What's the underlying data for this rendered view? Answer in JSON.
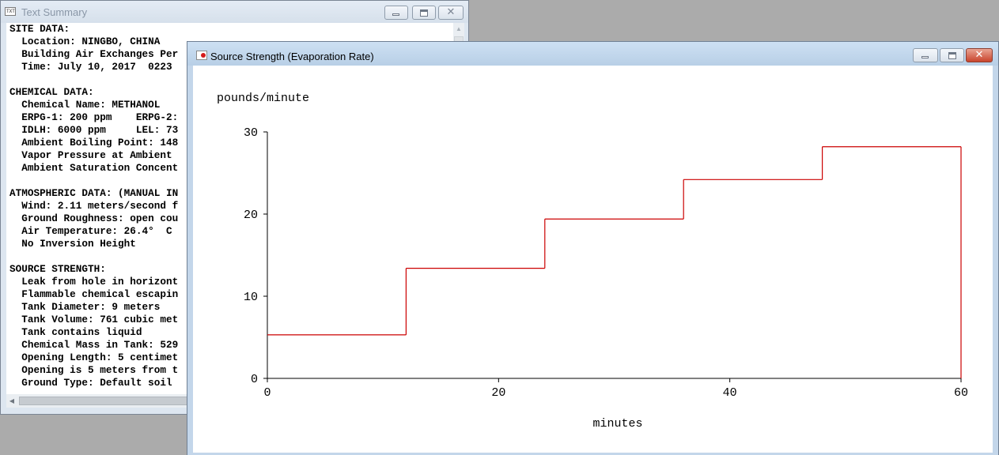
{
  "text_summary": {
    "title": "Text Summary",
    "icon": "text-document-icon",
    "lines": [
      "SITE DATA:",
      "  Location: NINGBO, CHINA",
      "  Building Air Exchanges Per",
      "  Time: July 10, 2017  0223",
      "",
      "CHEMICAL DATA:",
      "  Chemical Name: METHANOL",
      "  ERPG-1: 200 ppm    ERPG-2:",
      "  IDLH: 6000 ppm     LEL: 73",
      "  Ambient Boiling Point: 148",
      "  Vapor Pressure at Ambient",
      "  Ambient Saturation Concent",
      "",
      "ATMOSPHERIC DATA: (MANUAL IN",
      "  Wind: 2.11 meters/second f",
      "  Ground Roughness: open cou",
      "  Air Temperature: 26.4°  C",
      "  No Inversion Height",
      "",
      "SOURCE STRENGTH:",
      "  Leak from hole in horizont",
      "  Flammable chemical escapin",
      "  Tank Diameter: 9 meters",
      "  Tank Volume: 761 cubic met",
      "  Tank contains liquid",
      "  Chemical Mass in Tank: 529",
      "  Opening Length: 5 centimet",
      "  Opening is 5 meters from t",
      "  Ground Type: Default soil"
    ]
  },
  "source_strength": {
    "title": "Source Strength (Evaporation Rate)",
    "icon": "chart-window-icon"
  },
  "chart_data": {
    "type": "line",
    "step": true,
    "title": "",
    "ylabel": "pounds/minute",
    "xlabel": "minutes",
    "xlim": [
      0,
      60
    ],
    "ylim": [
      0,
      30
    ],
    "x_ticks": [
      "0",
      "20",
      "40",
      "60"
    ],
    "y_ticks": [
      "0",
      "10",
      "20",
      "30"
    ],
    "line_color": "#cc0000",
    "grid": false,
    "segments": [
      {
        "x0": 0,
        "x1": 12,
        "y": 5.3
      },
      {
        "x0": 12,
        "x1": 24,
        "y": 13.4
      },
      {
        "x0": 24,
        "x1": 36,
        "y": 19.4
      },
      {
        "x0": 36,
        "x1": 48,
        "y": 24.2
      },
      {
        "x0": 48,
        "x1": 60,
        "y": 28.2
      }
    ]
  }
}
